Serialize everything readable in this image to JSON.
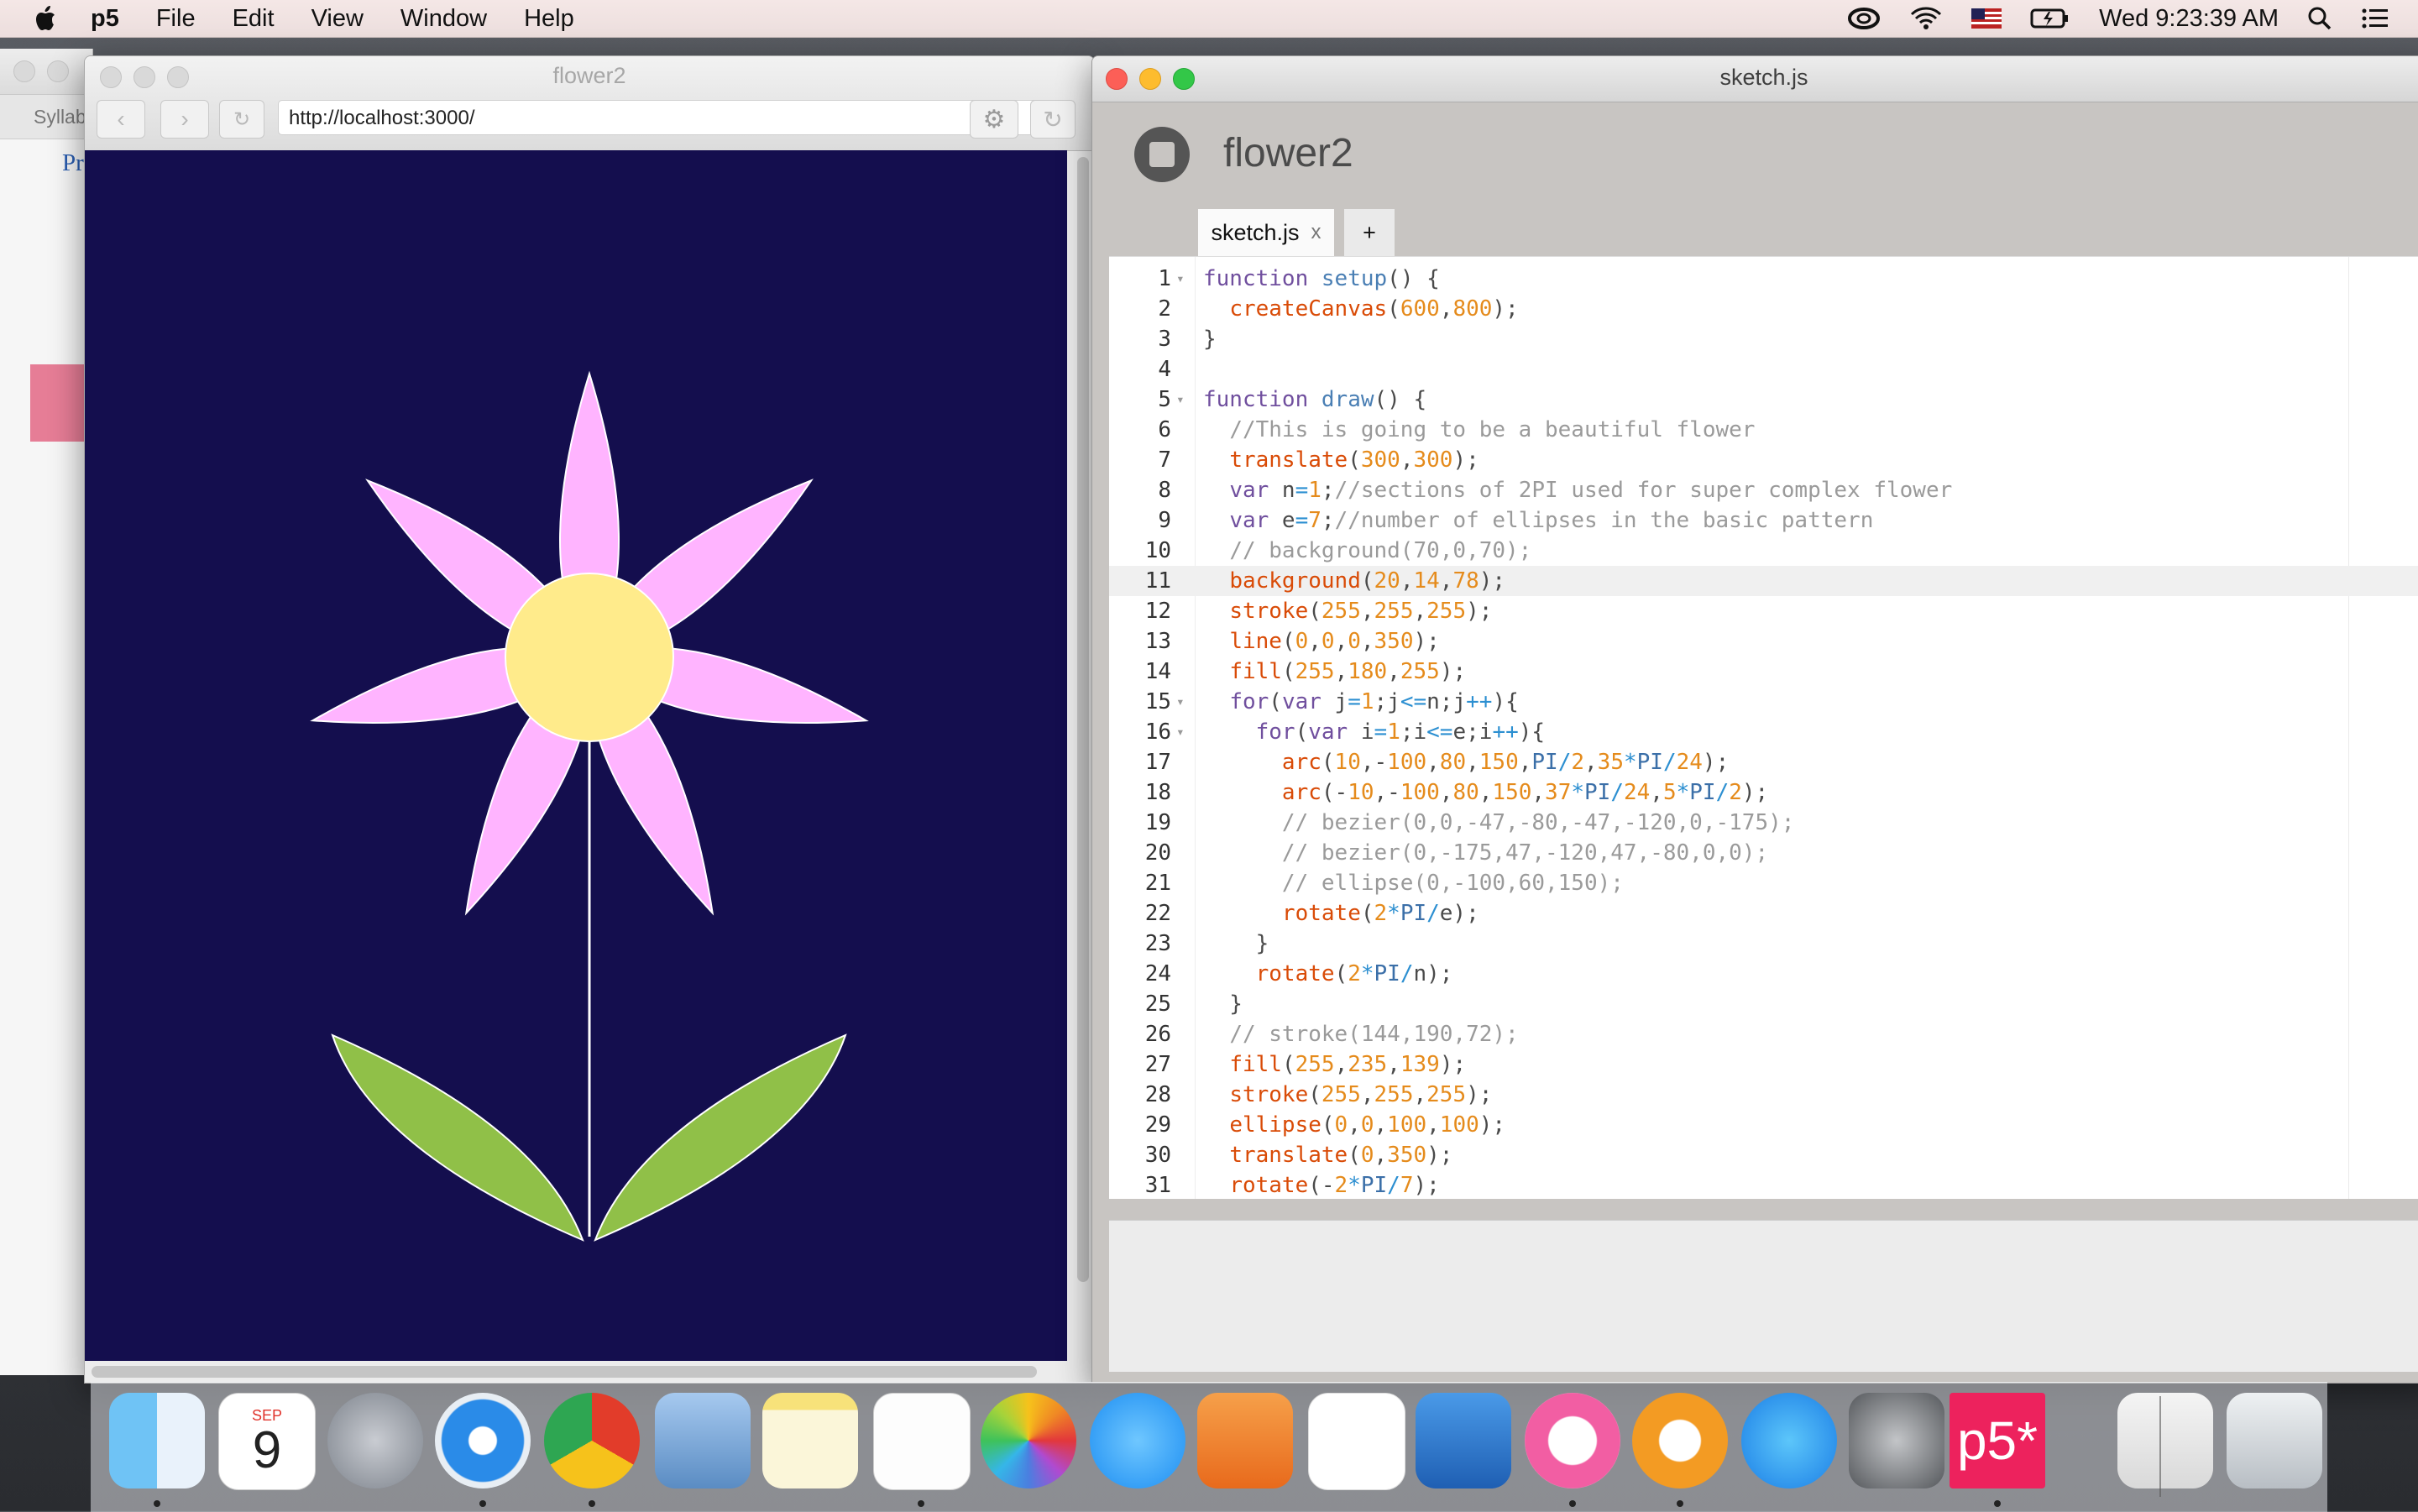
{
  "menubar": {
    "app_name": "p5",
    "items": [
      "File",
      "Edit",
      "View",
      "Window",
      "Help"
    ],
    "clock": "Wed 9:23:39 AM"
  },
  "background_window": {
    "tab_label": "Syllab",
    "text": "Pr"
  },
  "browser": {
    "title": "flower2",
    "url": "http://localhost:3000/",
    "canvas_background": "#140e4e",
    "petal_color": "#ffb4ff",
    "center_color": "#ffeb8b",
    "leaf_color": "#90c048"
  },
  "editor": {
    "window_title": "sketch.js",
    "sketch_name": "flower2",
    "tabs": [
      {
        "label": "sketch.js",
        "close": "x"
      },
      {
        "label": "+"
      }
    ],
    "active_line": 11,
    "lines": [
      "function setup() {",
      "  createCanvas(600,800);",
      "}",
      "",
      "function draw() {",
      "  //This is going to be a beautiful flower",
      "  translate(300,300);",
      "  var n=1;//sections of 2PI used for super complex flower",
      "  var e=7;//number of ellipses in the basic pattern",
      "  // background(70,0,70);",
      "  background(20,14,78);",
      "  stroke(255,255,255);",
      "  line(0,0,0,350);",
      "  fill(255,180,255);",
      "  for(var j=1;j<=n;j++){",
      "    for(var i=1;i<=e;i++){",
      "      arc(10,-100,80,150,PI/2,35*PI/24);",
      "      arc(-10,-100,80,150,37*PI/24,5*PI/2);",
      "      // bezier(0,0,-47,-80,-47,-120,0,-175);",
      "      // bezier(0,-175,47,-120,47,-80,0,0);",
      "      // ellipse(0,-100,60,150);",
      "      rotate(2*PI/e);",
      "    }",
      "    rotate(2*PI/n);",
      "  }",
      "  // stroke(144,190,72);",
      "  fill(255,235,139);",
      "  stroke(255,255,255);",
      "  ellipse(0,0,100,100);",
      "  translate(0,350);",
      "  rotate(-2*PI/7);"
    ]
  },
  "dock": {
    "items": [
      {
        "name": "finder",
        "icon": "finder-icon"
      },
      {
        "name": "calendar",
        "icon": "calendar-icon",
        "month": "SEP",
        "day": "9"
      },
      {
        "name": "launchpad",
        "icon": "rocket-icon"
      },
      {
        "name": "safari",
        "icon": "compass-icon"
      },
      {
        "name": "chrome",
        "icon": "chrome-icon"
      },
      {
        "name": "mail",
        "icon": "mail-icon"
      },
      {
        "name": "notes",
        "icon": "notes-icon"
      },
      {
        "name": "reminders",
        "icon": "reminders-icon"
      },
      {
        "name": "photos",
        "icon": "photos-icon"
      },
      {
        "name": "messages",
        "icon": "messages-icon"
      },
      {
        "name": "pages",
        "icon": "pages-icon"
      },
      {
        "name": "numbers",
        "icon": "numbers-icon"
      },
      {
        "name": "keynote",
        "icon": "keynote-icon"
      },
      {
        "name": "itunes",
        "icon": "music-icon"
      },
      {
        "name": "ibooks",
        "icon": "book-icon"
      },
      {
        "name": "app-store",
        "icon": "app-store-icon"
      },
      {
        "name": "system-preferences",
        "icon": "gear-icon"
      },
      {
        "name": "p5",
        "icon": "p5-icon",
        "label": "p5*"
      },
      {
        "name": "documents",
        "icon": "document-stack-icon"
      },
      {
        "name": "trash",
        "icon": "trash-icon"
      }
    ]
  }
}
